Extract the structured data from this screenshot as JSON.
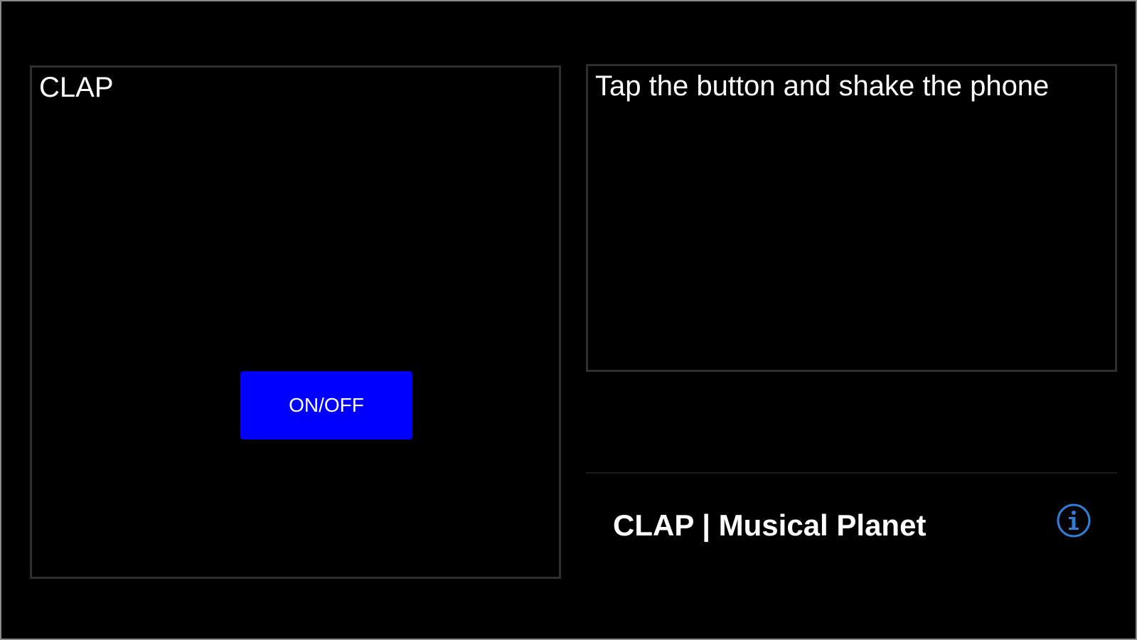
{
  "left_panel": {
    "title": "CLAP",
    "button_label": "ON/OFF",
    "button_color": "#0000ff"
  },
  "right_panel": {
    "instruction": "Tap the button and shake the phone"
  },
  "footer": {
    "title": "CLAP | Musical Planet",
    "info_icon": "info-icon",
    "info_icon_color": "#2f7fd8"
  }
}
